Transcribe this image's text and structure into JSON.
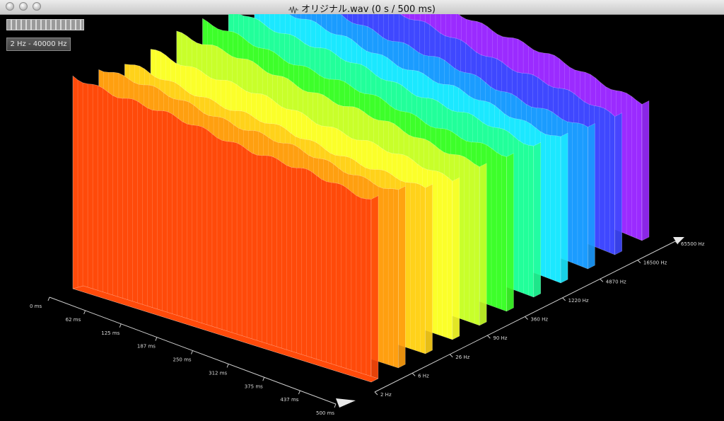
{
  "window": {
    "title": "オリジナル.wav (0 s / 500 ms)",
    "icon": "waveform-icon"
  },
  "controls": {
    "frequency_range": "2 Hz - 40000 Hz"
  },
  "chart_data": {
    "type": "area",
    "x_axis": {
      "unit": "ms",
      "ticks": [
        "0 ms",
        "62 ms",
        "125 ms",
        "187 ms",
        "250 ms",
        "312 ms",
        "375 ms",
        "437 ms",
        "500 ms"
      ]
    },
    "y_axis": {
      "unit": "Hz",
      "scale": "log",
      "ticks": [
        "2 Hz",
        "6 Hz",
        "26 Hz",
        "90 Hz",
        "360 Hz",
        "1220 Hz",
        "4870 Hz",
        "16500 Hz",
        "65500 Hz"
      ]
    },
    "bands": [
      {
        "color": "#ff4a0a",
        "level": 0.97
      },
      {
        "color": "#ff9f10",
        "level": 0.95
      },
      {
        "color": "#ffd21a",
        "level": 0.9
      },
      {
        "color": "#fbff2a",
        "level": 0.9
      },
      {
        "color": "#c8ff2a",
        "level": 0.92
      },
      {
        "color": "#3dff2a",
        "level": 0.9
      },
      {
        "color": "#22ff9a",
        "level": 0.9
      },
      {
        "color": "#1be8ff",
        "level": 0.88
      },
      {
        "color": "#1b9cff",
        "level": 0.86
      },
      {
        "color": "#3f48ff",
        "level": 0.88
      },
      {
        "color": "#9b2bff",
        "level": 0.9
      }
    ]
  }
}
